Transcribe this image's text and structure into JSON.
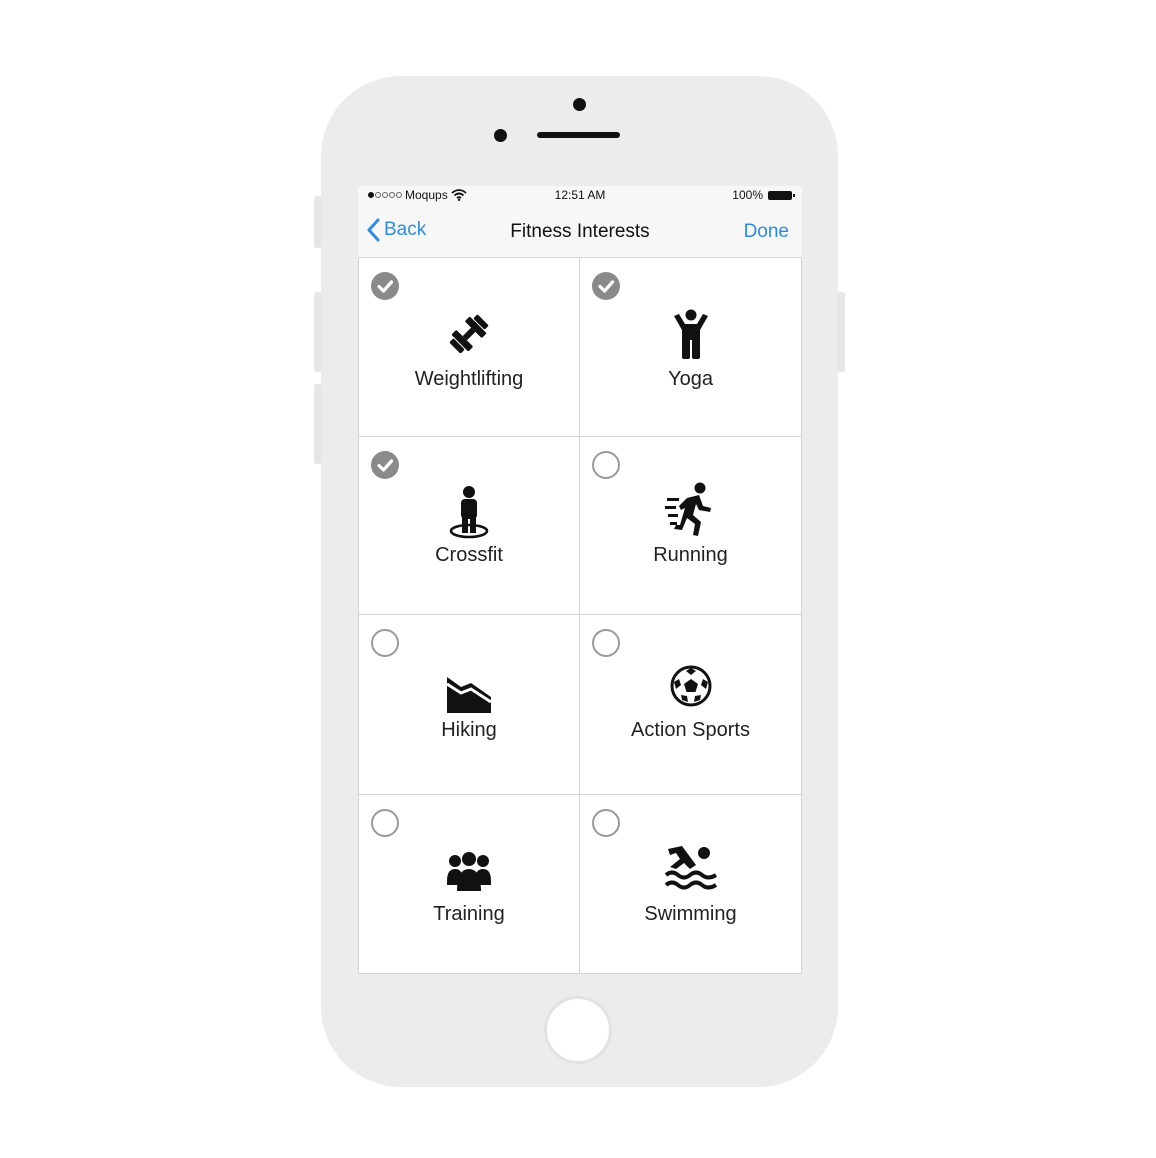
{
  "status_bar": {
    "carrier": "Moqups",
    "time": "12:51 AM",
    "battery": "100%"
  },
  "nav": {
    "back_label": "Back",
    "title": "Fitness Interests",
    "done_label": "Done"
  },
  "tiles": [
    {
      "label": "Weightlifting",
      "selected": true,
      "icon": "dumbbell-icon"
    },
    {
      "label": "Yoga",
      "selected": true,
      "icon": "yoga-icon"
    },
    {
      "label": "Crossfit",
      "selected": true,
      "icon": "crossfit-icon"
    },
    {
      "label": "Running",
      "selected": false,
      "icon": "running-icon"
    },
    {
      "label": "Hiking",
      "selected": false,
      "icon": "hiking-icon"
    },
    {
      "label": "Action Sports",
      "selected": false,
      "icon": "soccer-ball-icon"
    },
    {
      "label": "Training",
      "selected": false,
      "icon": "group-icon"
    },
    {
      "label": "Swimming",
      "selected": false,
      "icon": "swimming-icon"
    }
  ],
  "colors": {
    "accent": "#2f8ce5",
    "selected_check": "#8a8a8a",
    "phone_body": "#ececec"
  }
}
